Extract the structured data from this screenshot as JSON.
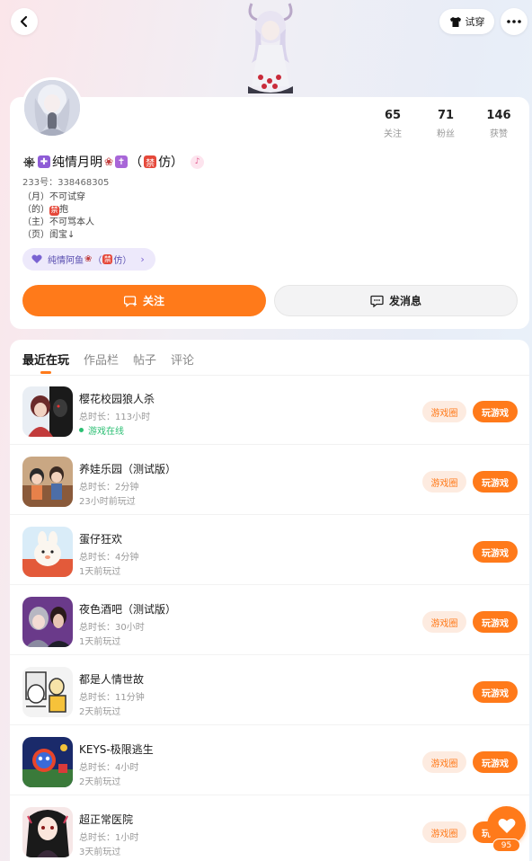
{
  "header": {
    "tryon_label": "试穿"
  },
  "profile": {
    "name_prefix": "纯情月明",
    "name_suffix": "（",
    "name_tag": "禁",
    "name_end": "仿）",
    "id_line": "233号：338468305",
    "bio": [
      "（月）不可试穿",
      "（的）",
      "（主）不可骂本人",
      "（页）闺宝↓"
    ],
    "bio_badge": "禁",
    "bio_badge_after": "抱",
    "group_chip": "纯情阿鱼",
    "group_chip_tag": "禁",
    "group_chip_end": "仿）",
    "stats": [
      {
        "value": "65",
        "label": "关注"
      },
      {
        "value": "71",
        "label": "粉丝"
      },
      {
        "value": "146",
        "label": "获赞"
      }
    ],
    "follow_label": "关注",
    "message_label": "发消息"
  },
  "tabs": [
    {
      "label": "最近在玩",
      "active": true
    },
    {
      "label": "作品栏",
      "active": false
    },
    {
      "label": "帖子",
      "active": false
    },
    {
      "label": "评论",
      "active": false
    }
  ],
  "games": [
    {
      "title": "樱花校园狼人杀",
      "duration": "总时长：113小时",
      "status": "游戏在线",
      "online": true,
      "has_circle": true
    },
    {
      "title": "养娃乐园（测试版）",
      "duration": "总时长：2分钟",
      "status": "23小时前玩过",
      "online": false,
      "has_circle": true
    },
    {
      "title": "蛋仔狂欢",
      "duration": "总时长：4分钟",
      "status": "1天前玩过",
      "online": false,
      "has_circle": false
    },
    {
      "title": "夜色酒吧（测试版）",
      "duration": "总时长：30小时",
      "status": "1天前玩过",
      "online": false,
      "has_circle": true
    },
    {
      "title": "都是人情世故",
      "duration": "总时长：11分钟",
      "status": "2天前玩过",
      "online": false,
      "has_circle": false
    },
    {
      "title": "KEYS-极限逃生",
      "duration": "总时长：4小时",
      "status": "2天前玩过",
      "online": false,
      "has_circle": true
    },
    {
      "title": "超正常医院",
      "duration": "总时长：1小时",
      "status": "3天前玩过",
      "online": false,
      "has_circle": true
    }
  ],
  "game_buttons": {
    "circle": "游戏圈",
    "play": "玩游戏"
  },
  "fab": {
    "count": "95"
  },
  "colors": {
    "accent": "#ff7a1a",
    "online": "#2bbf73",
    "chip_bg": "#ede9fb"
  }
}
